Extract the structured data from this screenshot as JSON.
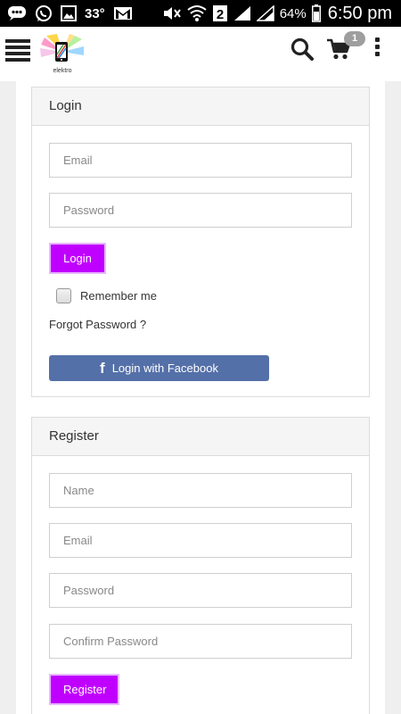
{
  "status_bar": {
    "temperature": "33°",
    "sim_slot": "2",
    "battery": "64%",
    "time": "6:50 pm"
  },
  "header": {
    "logo_text": "elektro",
    "cart_count": "1"
  },
  "login": {
    "title": "Login",
    "email_placeholder": "Email",
    "password_placeholder": "Password",
    "login_button": "Login",
    "remember_label": "Remember me",
    "forgot_link": "Forgot Password ?",
    "facebook_button": "Login with Facebook"
  },
  "register": {
    "title": "Register",
    "name_placeholder": "Name",
    "email_placeholder": "Email",
    "password_placeholder": "Password",
    "confirm_placeholder": "Confirm Password",
    "register_button": "Register"
  },
  "colors": {
    "accent": "#c000ff",
    "facebook": "#5470a8",
    "status_bar": "#000000"
  }
}
